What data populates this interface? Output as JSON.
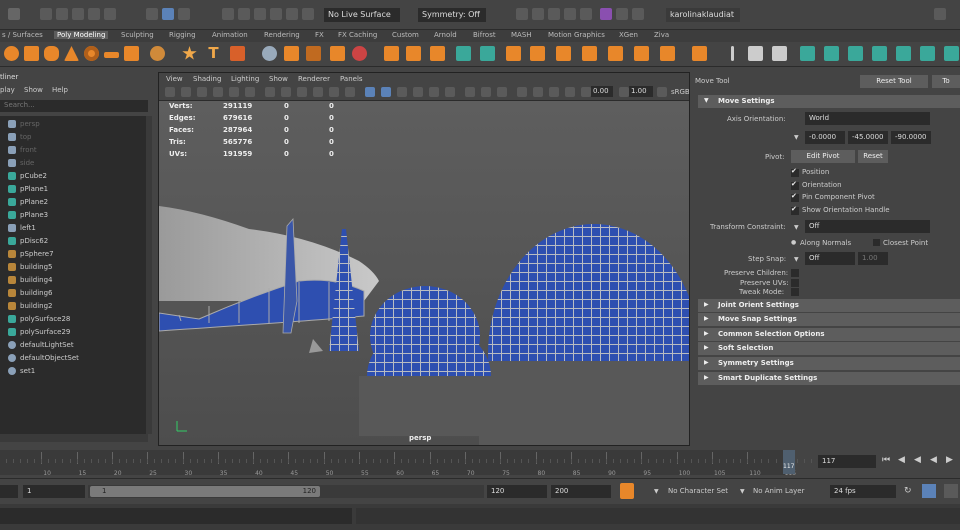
{
  "status_line": {
    "live_surface": "No Live Surface",
    "symmetry": "Symmetry: Off",
    "user": "karolinaklaudiat"
  },
  "shelf_tabs": [
    {
      "label": "s / Surfaces",
      "active": false
    },
    {
      "label": "Poly Modeling",
      "active": true
    },
    {
      "label": "Sculpting",
      "active": false
    },
    {
      "label": "Rigging",
      "active": false
    },
    {
      "label": "Animation",
      "active": false
    },
    {
      "label": "Rendering",
      "active": false
    },
    {
      "label": "FX",
      "active": false
    },
    {
      "label": "FX Caching",
      "active": false
    },
    {
      "label": "Custom",
      "active": false
    },
    {
      "label": "Arnold",
      "active": false
    },
    {
      "label": "Bifrost",
      "active": false
    },
    {
      "label": "MASH",
      "active": false
    },
    {
      "label": "Motion Graphics",
      "active": false
    },
    {
      "label": "XGen",
      "active": false
    },
    {
      "label": "Ziva",
      "active": false
    }
  ],
  "outliner": {
    "title": "tliner",
    "menu": [
      "play",
      "Show",
      "Help"
    ],
    "search_placeholder": "Search...",
    "items": [
      {
        "name": "persp",
        "type": "camera",
        "dim": true
      },
      {
        "name": "top",
        "type": "camera",
        "dim": true
      },
      {
        "name": "front",
        "type": "camera",
        "dim": true
      },
      {
        "name": "side",
        "type": "camera",
        "dim": true
      },
      {
        "name": "pCube2",
        "type": "mesh",
        "dim": false
      },
      {
        "name": "pPlane1",
        "type": "mesh",
        "dim": false
      },
      {
        "name": "pPlane2",
        "type": "mesh",
        "dim": false
      },
      {
        "name": "pPlane3",
        "type": "mesh",
        "dim": false
      },
      {
        "name": "left1",
        "type": "camera",
        "dim": false
      },
      {
        "name": "pDisc62",
        "type": "mesh",
        "dim": false
      },
      {
        "name": "pSphere7",
        "type": "group",
        "dim": false
      },
      {
        "name": "building5",
        "type": "group",
        "dim": false
      },
      {
        "name": "building4",
        "type": "group",
        "dim": false
      },
      {
        "name": "building6",
        "type": "group",
        "dim": false
      },
      {
        "name": "building2",
        "type": "group",
        "dim": false
      },
      {
        "name": "polySurface28",
        "type": "mesh",
        "dim": false
      },
      {
        "name": "polySurface29",
        "type": "mesh",
        "dim": false
      },
      {
        "name": "defaultLightSet",
        "type": "set",
        "dim": false
      },
      {
        "name": "defaultObjectSet",
        "type": "set",
        "dim": false
      },
      {
        "name": "set1",
        "type": "set",
        "dim": false
      }
    ]
  },
  "viewport": {
    "menu": [
      "View",
      "Shading",
      "Lighting",
      "Show",
      "Renderer",
      "Panels"
    ],
    "exposure": "0.00",
    "gamma": "1.00",
    "color_space": "sRGB",
    "camera_label": "persp",
    "hud": [
      {
        "label": "Verts:",
        "v1": "291119",
        "v2": "0",
        "v3": "0"
      },
      {
        "label": "Edges:",
        "v1": "679616",
        "v2": "0",
        "v3": "0"
      },
      {
        "label": "Faces:",
        "v1": "287964",
        "v2": "0",
        "v3": "0"
      },
      {
        "label": "Tris:",
        "v1": "565776",
        "v2": "0",
        "v3": "0"
      },
      {
        "label": "UVs:",
        "v1": "191959",
        "v2": "0",
        "v3": "0"
      }
    ]
  },
  "attr": {
    "title": "Move Tool",
    "reset_tool": "Reset Tool",
    "tool_help": "To",
    "move_settings": "Move Settings",
    "axis_orientation_label": "Axis Orientation:",
    "axis_orientation_value": "World",
    "orient_x": "-0.0000",
    "orient_y": "-45.0000",
    "orient_z": "-90.0000",
    "pivot_label": "Pivot:",
    "edit_pivot": "Edit Pivot",
    "reset": "Reset",
    "checks": [
      {
        "label": "Position",
        "on": true
      },
      {
        "label": "Orientation",
        "on": true
      },
      {
        "label": "Pin Component Pivot",
        "on": true
      },
      {
        "label": "Show Orientation Handle",
        "on": true
      }
    ],
    "transform_constraint_label": "Transform Constraint:",
    "transform_constraint_value": "Off",
    "along_normals": "Along Normals",
    "closest_point": "Closest Point",
    "step_snap_label": "Step Snap:",
    "step_snap_value": "Off",
    "step_snap_amount": "1.00",
    "preserve_children": "Preserve Children:",
    "preserve_uvs": "Preserve UVs:",
    "tweak_mode": "Tweak Mode:",
    "sections": [
      "Joint Orient Settings",
      "Move Snap Settings",
      "Common Selection Options",
      "Soft Selection",
      "Symmetry Settings",
      "Smart Duplicate Settings"
    ]
  },
  "time_slider": {
    "ticks": [
      "10",
      "15",
      "20",
      "25",
      "30",
      "35",
      "40",
      "45",
      "50",
      "55",
      "60",
      "65",
      "70",
      "75",
      "80",
      "85",
      "90",
      "95",
      "100",
      "105",
      "110",
      "115"
    ],
    "current_frame_marker": "117",
    "current_frame": "117"
  },
  "range_slider": {
    "start": "1",
    "range_start": "1",
    "range_end_inner": "120",
    "range_end": "120",
    "anim_end": "200",
    "character_set": "No Character Set",
    "anim_layer": "No Anim Layer",
    "fps": "24 fps"
  },
  "colors": {
    "panel": "#444444",
    "field": "#2b2b2b",
    "glass_blue": "#2e4fb0",
    "accent_orange": "#e8872a",
    "mesh_green": "#3aa89a"
  }
}
